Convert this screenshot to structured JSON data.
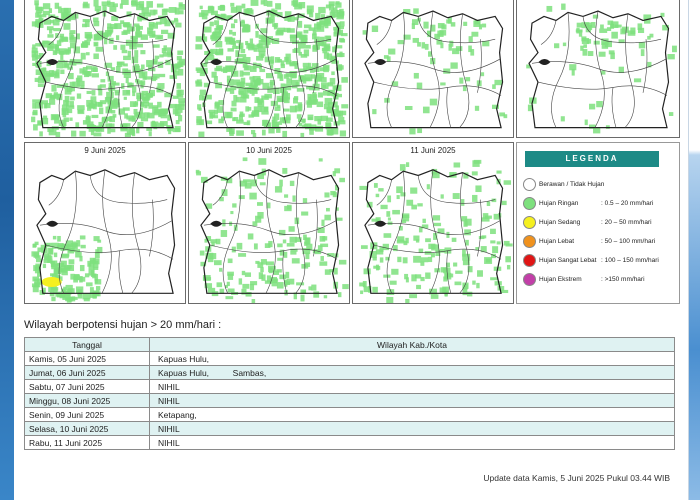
{
  "maps": [
    {
      "title": "",
      "rain": "heavy"
    },
    {
      "title": "",
      "rain": "heavy"
    },
    {
      "title": "",
      "rain": "light"
    },
    {
      "title": "",
      "rain": "light"
    },
    {
      "title": "9 Juni 2025",
      "rain": "southwest"
    },
    {
      "title": "10 Juni 2025",
      "rain": "medium"
    },
    {
      "title": "11 Juni 2025",
      "rain": "medium"
    }
  ],
  "legend": {
    "title": "LEGENDA",
    "items": [
      {
        "name": "Berawan / Tidak Hujan",
        "range": "",
        "color": "#ffffff"
      },
      {
        "name": "Hujan Ringan",
        "range": ": 0.5 – 20 mm/hari",
        "color": "#7ee07e"
      },
      {
        "name": "Hujan Sedang",
        "range": ": 20 – 50 mm/hari",
        "color": "#f5f020"
      },
      {
        "name": "Hujan Lebat",
        "range": ": 50 – 100 mm/hari",
        "color": "#f0921e"
      },
      {
        "name": "Hujan Sangat Lebat",
        "range": ": 100 – 150 mm/hari",
        "color": "#e01515"
      },
      {
        "name": "Hujan Ekstrem",
        "range": ": >150 mm/hari",
        "color": "#c23fa8"
      }
    ]
  },
  "table": {
    "heading": "Wilayah berpotensi hujan > 20 mm/hari :",
    "headers": [
      "Tanggal",
      "Wilayah Kab./Kota"
    ],
    "rows": [
      {
        "date": "Kamis, 05 Juni 2025",
        "region": "Kapuas Hulu,"
      },
      {
        "date": "Jumat, 06 Juni 2025",
        "region": "Kapuas Hulu,          Sambas,"
      },
      {
        "date": "Sabtu, 07 Juni 2025",
        "region": "NIHIL"
      },
      {
        "date": "Minggu, 08 Juni 2025",
        "region": "NIHIL"
      },
      {
        "date": "Senin, 09 Juni 2025",
        "region": "Ketapang,"
      },
      {
        "date": "Selasa, 10 Juni 2025",
        "region": "NIHIL"
      },
      {
        "date": "Rabu, 11 Juni 2025",
        "region": "NIHIL"
      }
    ]
  },
  "update_text": "Update data Kamis, 5 Juni 2025 Pukul 03.44 WIB"
}
